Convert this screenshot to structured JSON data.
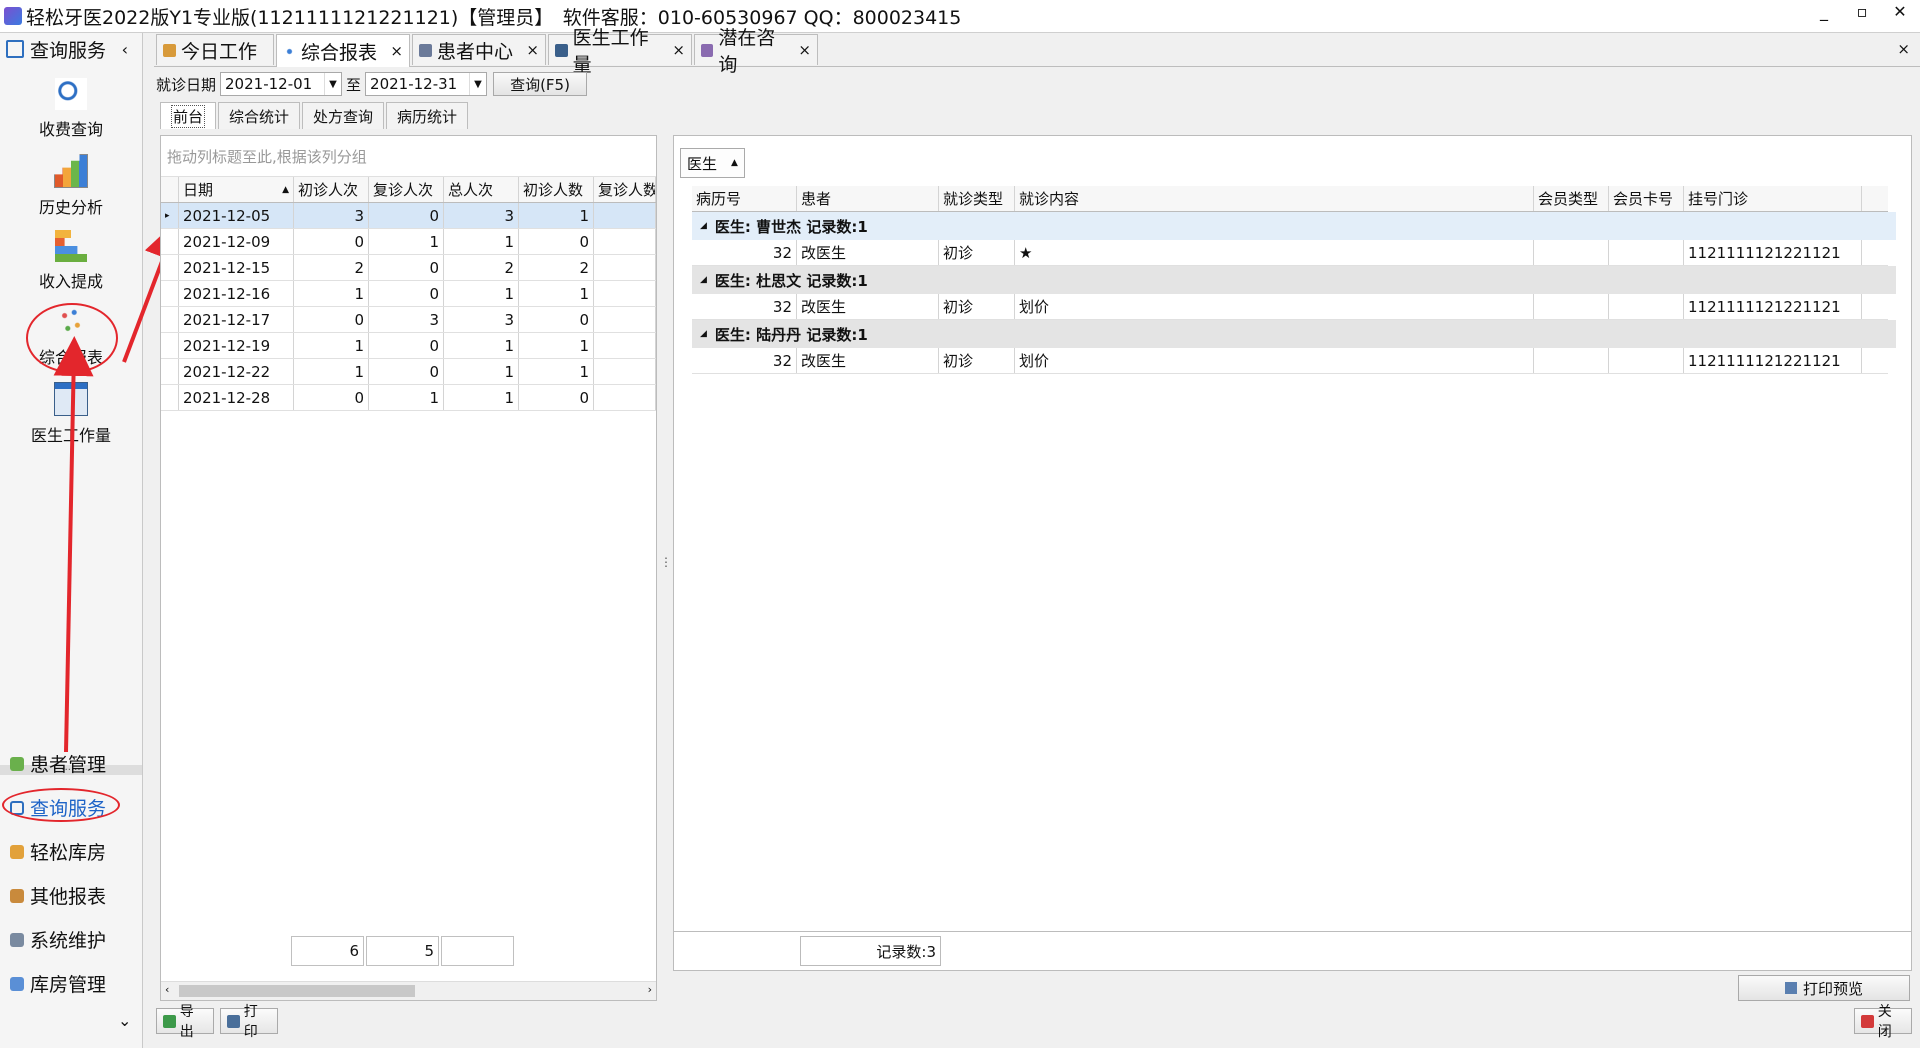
{
  "window": {
    "title": "轻松牙医2022版Y1专业版(1121111121221121)【管理员】　软件客服：010-60530967 QQ：800023415",
    "minimize": "_",
    "restore": "▫",
    "close": "✕"
  },
  "sidebar": {
    "header": "查询服务",
    "collapse": "‹",
    "items": [
      {
        "label": "收费查询",
        "icon": "magnifier-chart-icon"
      },
      {
        "label": "历史分析",
        "icon": "bar-chart-icon"
      },
      {
        "label": "收入提成",
        "icon": "stacked-bars-icon"
      },
      {
        "label": "综合报表",
        "icon": "scatter-report-icon"
      },
      {
        "label": "医生工作量",
        "icon": "calendar-table-icon"
      }
    ],
    "splitter": "......",
    "nav": [
      {
        "label": "患者管理"
      },
      {
        "label": "查询服务"
      },
      {
        "label": "轻松库房"
      },
      {
        "label": "其他报表"
      },
      {
        "label": "系统维护"
      },
      {
        "label": "库房管理"
      }
    ],
    "more": "⌄"
  },
  "tabs": [
    {
      "label": "今日工作",
      "close": ""
    },
    {
      "label": "综合报表",
      "close": "×"
    },
    {
      "label": "患者中心",
      "close": "×"
    },
    {
      "label": "医生工作量",
      "close": "×"
    },
    {
      "label": "潜在咨询",
      "close": "×"
    }
  ],
  "close_all": "×",
  "filter": {
    "date_label": "就诊日期",
    "from": "2021-12-01",
    "to_label": "至",
    "to": "2021-12-31",
    "query_button": "查询(F5)"
  },
  "subtabs": [
    "前台",
    "综合统计",
    "处方查询",
    "病历统计"
  ],
  "left_grid": {
    "group_hint": "拖动列标题至此,根据该列分组",
    "columns": [
      "日期",
      "初诊人次",
      "复诊人次",
      "总人次",
      "初诊人数",
      "复诊人数"
    ],
    "rows": [
      [
        "2021-12-05",
        "3",
        "0",
        "3",
        "1",
        ""
      ],
      [
        "2021-12-09",
        "0",
        "1",
        "1",
        "0",
        ""
      ],
      [
        "2021-12-15",
        "2",
        "0",
        "2",
        "2",
        ""
      ],
      [
        "2021-12-16",
        "1",
        "0",
        "1",
        "1",
        ""
      ],
      [
        "2021-12-17",
        "0",
        "3",
        "3",
        "0",
        ""
      ],
      [
        "2021-12-19",
        "1",
        "0",
        "1",
        "1",
        ""
      ],
      [
        "2021-12-22",
        "1",
        "0",
        "1",
        "1",
        ""
      ],
      [
        "2021-12-28",
        "0",
        "1",
        "1",
        "0",
        ""
      ]
    ],
    "sums": [
      "6",
      "5",
      ""
    ]
  },
  "right_grid": {
    "group_by": "医生",
    "group_sort": "▲",
    "columns": [
      "病历号",
      "患者",
      "就诊类型",
      "就诊内容",
      "会员类型",
      "会员卡号",
      "挂号门诊"
    ],
    "groups": [
      {
        "header": "医生: 曹世杰 记录数:1",
        "row": [
          "32",
          "改医生",
          "初诊",
          "★",
          "",
          "",
          "1121111121221121"
        ]
      },
      {
        "header": "医生: 杜思文 记录数:1",
        "row": [
          "32",
          "改医生",
          "初诊",
          "划价",
          "",
          "",
          "1121111121221121"
        ]
      },
      {
        "header": "医生: 陆丹丹 记录数:1",
        "row": [
          "32",
          "改医生",
          "初诊",
          "划价",
          "",
          "",
          "1121111121221121"
        ]
      }
    ],
    "record_count": "记录数:3",
    "print_preview": "打印预览"
  },
  "bottom": {
    "export": "导出",
    "print": "打印",
    "close": "关闭"
  }
}
